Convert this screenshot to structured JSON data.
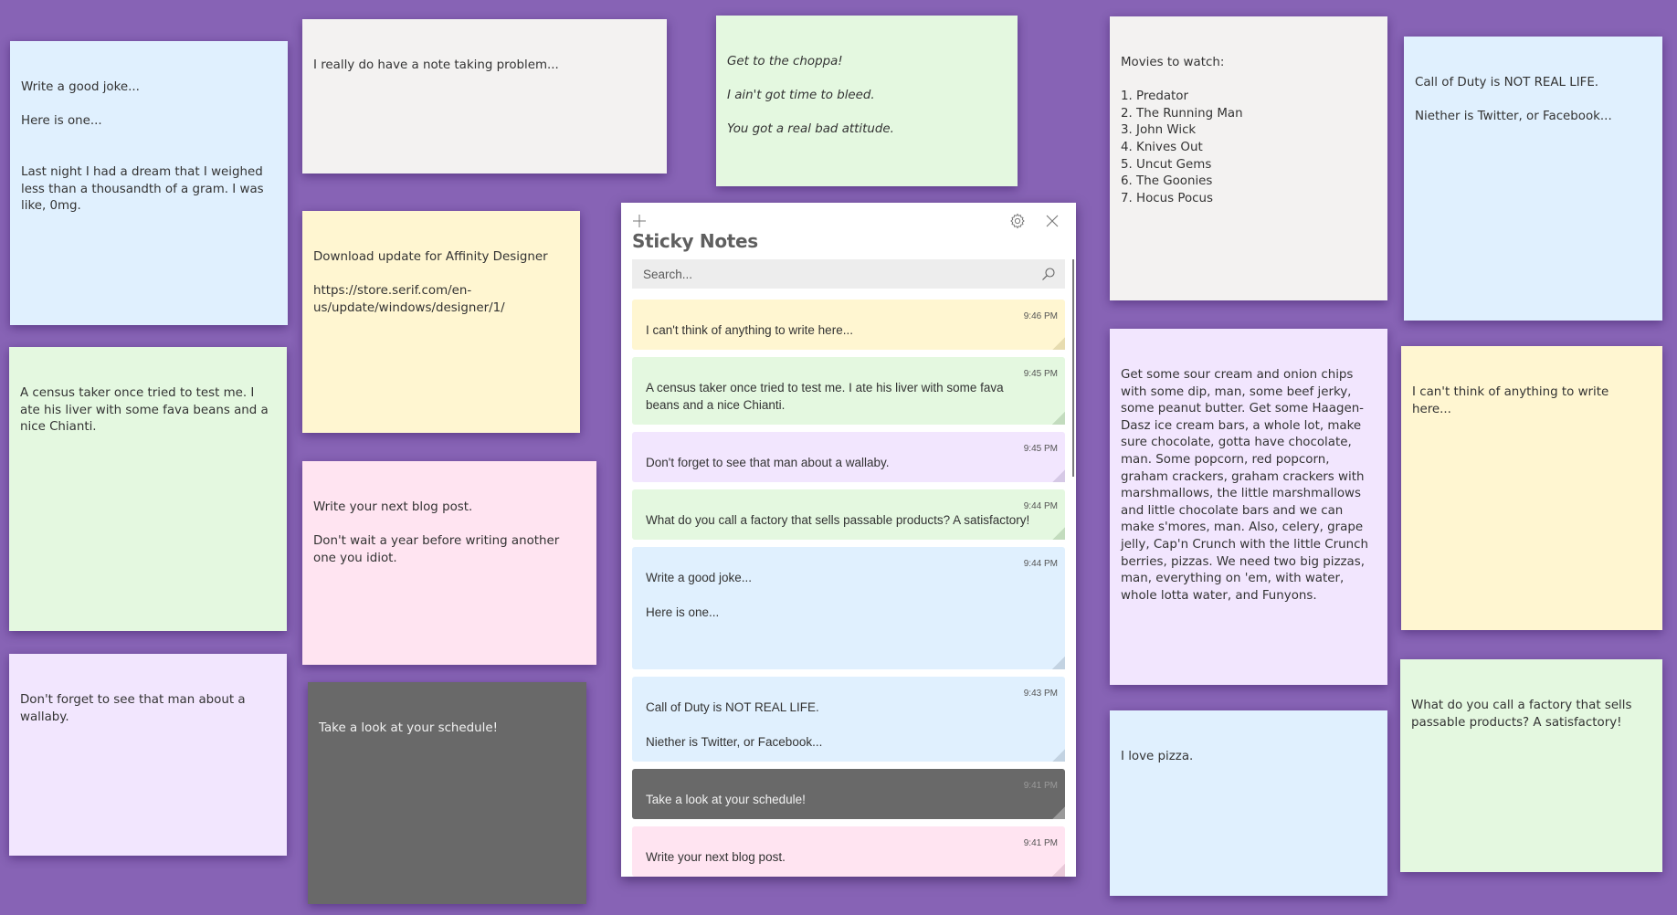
{
  "background_color": "#8763b5",
  "desktop_notes": [
    {
      "id": "joke",
      "color": "blue",
      "italic": false,
      "text": "Write a good joke...\n\nHere is one...\n\n\nLast night I had a dream that I weighed less than a thousandth of a gram. I was like, 0mg."
    },
    {
      "id": "note-taking",
      "color": "gray",
      "italic": false,
      "text": "I really do have a note taking problem..."
    },
    {
      "id": "choppa",
      "color": "green",
      "italic": true,
      "text": "Get to the choppa!\n\nI ain't got time to bleed.\n\nYou got a real bad attitude."
    },
    {
      "id": "movies",
      "color": "gray",
      "italic": false,
      "text": "Movies to watch:\n\n1. Predator\n2. The Running Man\n3. John Wick\n4. Knives Out\n5. Uncut Gems\n6. The Goonies\n7. Hocus Pocus"
    },
    {
      "id": "call-of-duty",
      "color": "blue",
      "italic": false,
      "text": "Call of Duty is NOT REAL LIFE.\n\nNiether is Twitter, or Facebook..."
    },
    {
      "id": "affinity",
      "color": "yellow",
      "italic": false,
      "text": "Download update for Affinity Designer\n\nhttps://store.serif.com/en-us/update/windows/designer/1/"
    },
    {
      "id": "census",
      "color": "green",
      "italic": false,
      "text": "A census taker once tried to test me. I ate his liver with some fava beans and a nice Chianti."
    },
    {
      "id": "blog",
      "color": "pink",
      "italic": false,
      "text": "Write your next blog post.\n\nDon't wait a year before writing another one you idiot."
    },
    {
      "id": "wallaby",
      "color": "purple",
      "italic": false,
      "text": "Don't forget to see that man about a wallaby."
    },
    {
      "id": "schedule",
      "color": "charcoal",
      "italic": false,
      "text": "Take a look at your schedule!"
    },
    {
      "id": "shopping",
      "color": "purple",
      "italic": false,
      "text": "Get some sour cream and onion chips with some dip, man, some beef jerky, some peanut butter. Get some Haagen-Dasz ice cream bars, a whole lot, make sure chocolate, gotta have chocolate, man. Some popcorn, red popcorn, graham crackers, graham crackers with marshmallows, the little marshmallows and little chocolate bars and we can make s'mores, man. Also, celery, grape jelly, Cap'n Crunch with the little Crunch berries, pizzas. We need two big pizzas, man, everything on 'em, with water, whole lotta water, and Funyons."
    },
    {
      "id": "think",
      "color": "yellow",
      "italic": false,
      "text": "I can't think of anything to write here..."
    },
    {
      "id": "pizza",
      "color": "blue",
      "italic": false,
      "text": "I love pizza."
    },
    {
      "id": "factory",
      "color": "green",
      "italic": false,
      "text": "What do you call a factory that sells passable products? A satisfactory!"
    }
  ],
  "panel": {
    "title": "Sticky Notes",
    "add_icon": "plus-icon",
    "settings_icon": "gear-icon",
    "close_icon": "close-icon",
    "search": {
      "placeholder": "Search...",
      "value": "",
      "icon": "search-icon"
    },
    "items": [
      {
        "color": "yellow",
        "time": "9:46 PM",
        "text": "I can't think of anything to write here..."
      },
      {
        "color": "green",
        "time": "9:45 PM",
        "text": "A census taker once tried to test me. I ate his liver with some fava beans and a nice Chianti."
      },
      {
        "color": "purple",
        "time": "9:45 PM",
        "text": "Don't forget to see that man about a wallaby."
      },
      {
        "color": "green",
        "time": "9:44 PM",
        "text": "What do you call a factory that sells passable products? A satisfactory!"
      },
      {
        "color": "blue",
        "time": "9:44 PM",
        "text": "Write a good joke...\n\nHere is one...\n\n"
      },
      {
        "color": "blue",
        "time": "9:43 PM",
        "text": "Call of Duty is NOT REAL LIFE.\n\nNiether is Twitter, or Facebook..."
      },
      {
        "color": "charcoal",
        "time": "9:41 PM",
        "text": "Take a look at your schedule!"
      },
      {
        "color": "pink",
        "time": "9:41 PM",
        "text": "Write your next blog post."
      }
    ]
  },
  "colors": {
    "yellow": "#fff6d1",
    "green": "#e4f8e0",
    "pink": "#ffe4f1",
    "purple": "#f2e6fe",
    "blue": "#e0f0fe",
    "gray": "#f3f2f1",
    "charcoal": "#696969"
  }
}
